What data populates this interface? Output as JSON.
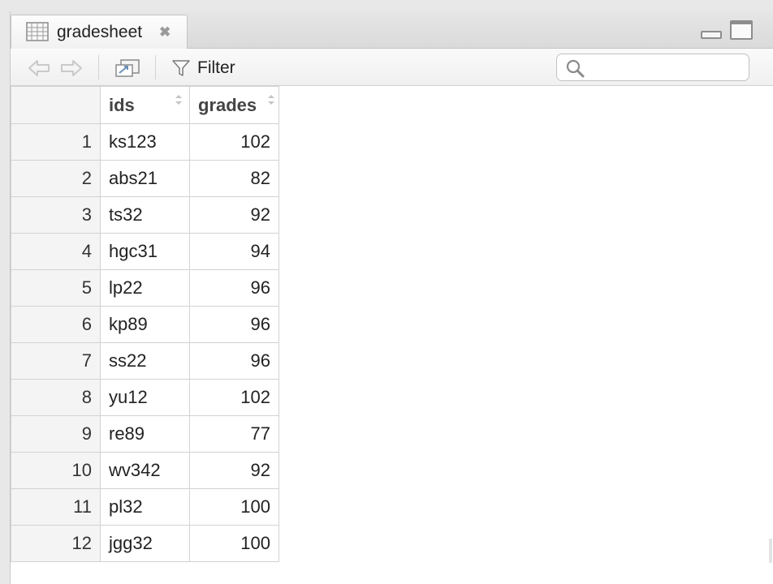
{
  "tab": {
    "label": "gradesheet",
    "close": "✖",
    "icon": "table-grid-icon"
  },
  "toolbar": {
    "filter_label": "Filter",
    "search_placeholder": ""
  },
  "table": {
    "columns": [
      "ids",
      "grades"
    ],
    "rows": [
      {
        "n": "1",
        "ids": "ks123",
        "grades": "102"
      },
      {
        "n": "2",
        "ids": "abs21",
        "grades": "82"
      },
      {
        "n": "3",
        "ids": "ts32",
        "grades": "92"
      },
      {
        "n": "4",
        "ids": "hgc31",
        "grades": "94"
      },
      {
        "n": "5",
        "ids": "lp22",
        "grades": "96"
      },
      {
        "n": "6",
        "ids": "kp89",
        "grades": "96"
      },
      {
        "n": "7",
        "ids": "ss22",
        "grades": "96"
      },
      {
        "n": "8",
        "ids": "yu12",
        "grades": "102"
      },
      {
        "n": "9",
        "ids": "re89",
        "grades": "77"
      },
      {
        "n": "10",
        "ids": "wv342",
        "grades": "92"
      },
      {
        "n": "11",
        "ids": "pl32",
        "grades": "100"
      },
      {
        "n": "12",
        "ids": "jgg32",
        "grades": "100"
      }
    ]
  },
  "colors": {
    "border": "#d2d2d2",
    "rownum_bg": "#f4f4f4",
    "icon_gray": "#9a9a9a"
  }
}
